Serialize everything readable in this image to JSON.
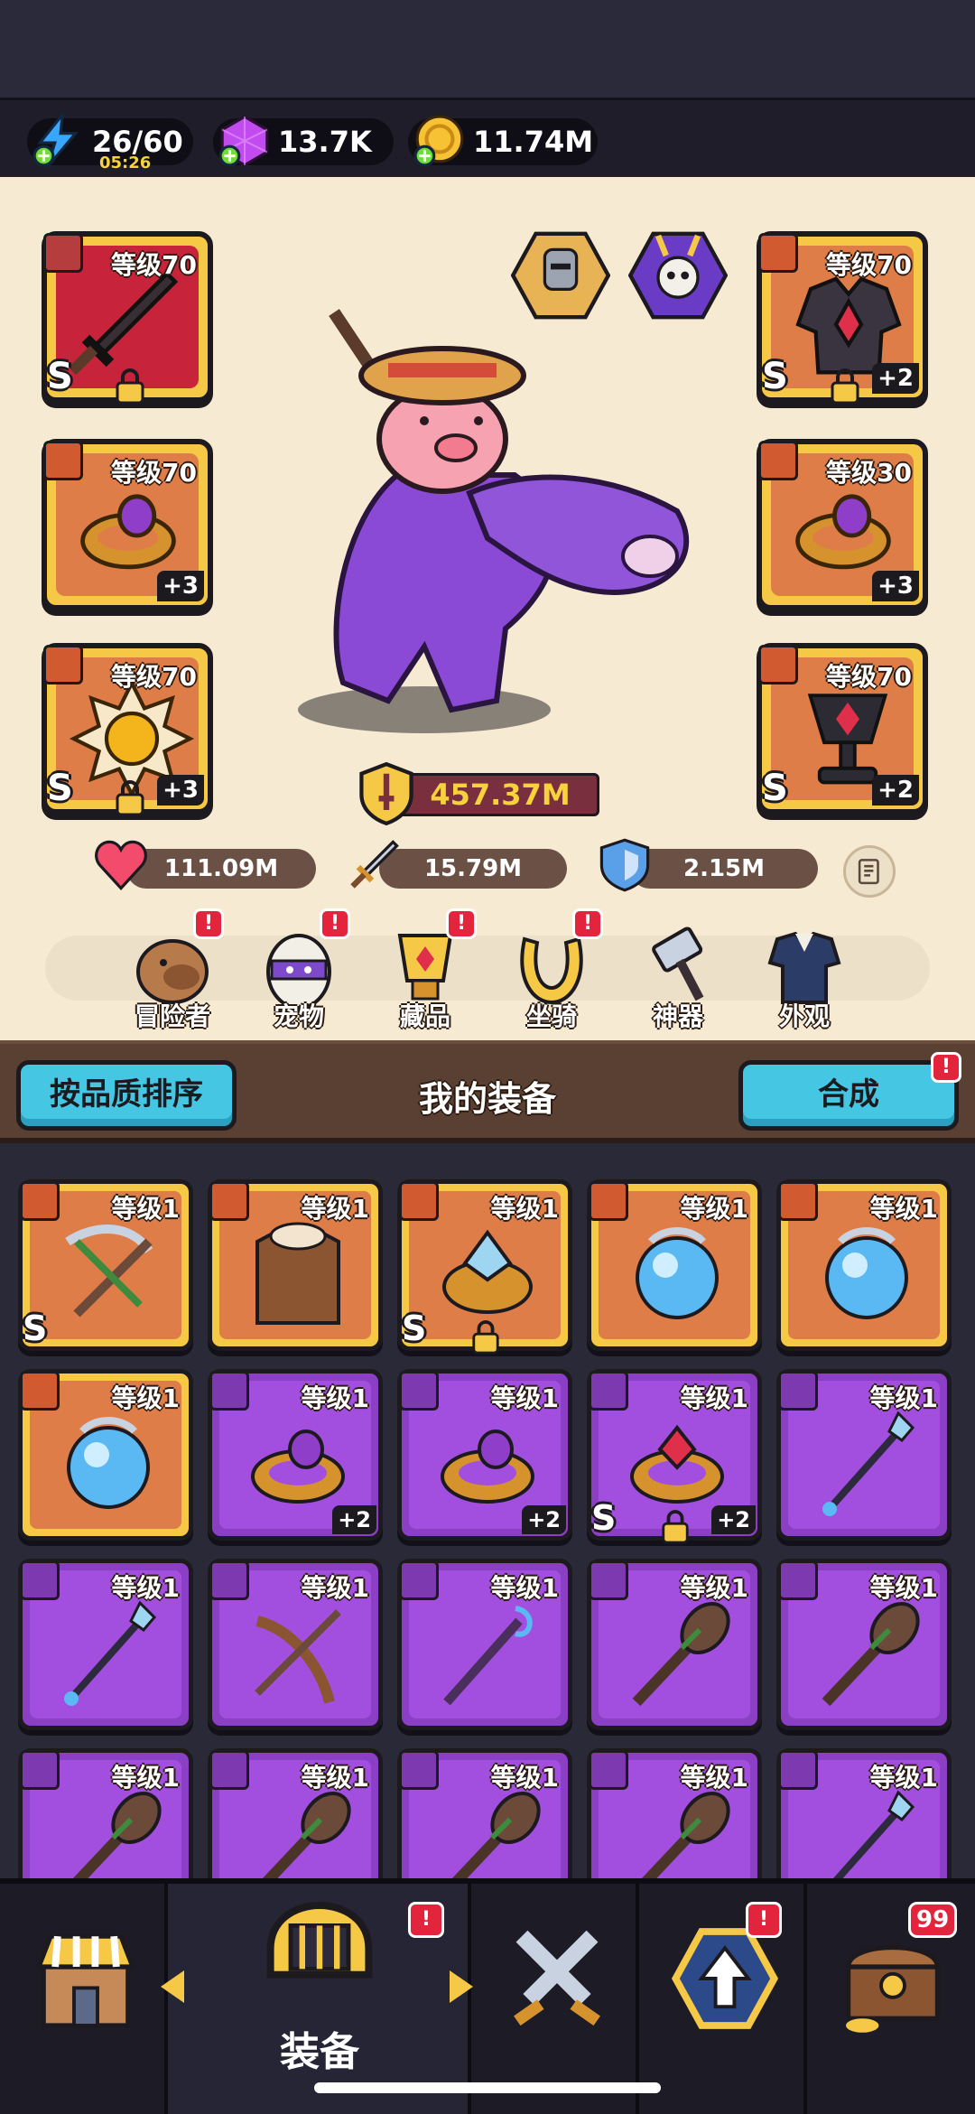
{
  "resources": {
    "energy": {
      "value": "26/60",
      "timer": "05:26",
      "icon": "lightning-plus-icon"
    },
    "gems": {
      "value": "13.7K",
      "icon": "purple-gem-plus-icon"
    },
    "coins": {
      "value": "11.74M",
      "icon": "gold-coin-plus-icon"
    }
  },
  "equipment_slots": {
    "weapon": {
      "level": "等级70",
      "grade": "S",
      "locked": true,
      "icon": "sword-icon"
    },
    "armor": {
      "level": "等级70",
      "grade": "S",
      "plus": "+2",
      "locked": true,
      "icon": "armor-icon"
    },
    "ring_left": {
      "level": "等级70",
      "plus": "+3",
      "icon": "ring-icon"
    },
    "ring_right": {
      "level": "等级30",
      "plus": "+3",
      "icon": "ring-icon"
    },
    "necklace_left": {
      "level": "等级70",
      "grade": "S",
      "plus": "+3",
      "locked": true,
      "icon": "amulet-icon"
    },
    "necklace_right": {
      "level": "等级70",
      "grade": "S",
      "plus": "+2",
      "icon": "chalice-icon"
    }
  },
  "power": {
    "value": "457.37M",
    "icon": "shield-sword-icon"
  },
  "stats": {
    "hp": {
      "value": "111.09M",
      "icon": "heart-icon"
    },
    "attack": {
      "value": "15.79M",
      "icon": "sword-icon"
    },
    "defense": {
      "value": "2.15M",
      "icon": "shield-icon"
    }
  },
  "menu": [
    {
      "label": "冒险者",
      "icon": "capybara-icon",
      "badge": "!"
    },
    {
      "label": "宠物",
      "icon": "egg-icon",
      "badge": "!"
    },
    {
      "label": "藏品",
      "icon": "trophy-icon",
      "badge": "!"
    },
    {
      "label": "坐骑",
      "icon": "horseshoe-icon",
      "badge": "!"
    },
    {
      "label": "神器",
      "icon": "hammer-icon"
    },
    {
      "label": "外观",
      "icon": "outfit-icon"
    }
  ],
  "inventory_header": {
    "sort_label": "按品质排序",
    "title": "我的装备",
    "merge_label": "合成",
    "merge_badge": "!"
  },
  "inventory": [
    {
      "level": "等级1",
      "rarity": "orange",
      "item": "crossbow",
      "grade": "S"
    },
    {
      "level": "等级1",
      "rarity": "orange",
      "item": "fur-armor"
    },
    {
      "level": "等级1",
      "rarity": "orange",
      "item": "crystal-ring",
      "grade": "S",
      "locked": true
    },
    {
      "level": "等级1",
      "rarity": "orange",
      "item": "blue-orb"
    },
    {
      "level": "等级1",
      "rarity": "orange",
      "item": "blue-orb"
    },
    {
      "level": "等级1",
      "rarity": "orange",
      "item": "blue-orb"
    },
    {
      "level": "等级1",
      "rarity": "purple",
      "item": "gold-ring",
      "plus": "+2"
    },
    {
      "level": "等级1",
      "rarity": "purple",
      "item": "gold-ring",
      "plus": "+2"
    },
    {
      "level": "等级1",
      "rarity": "purple",
      "item": "ruby-ring",
      "plus": "+2",
      "grade": "S",
      "locked": true
    },
    {
      "level": "等级1",
      "rarity": "purple",
      "item": "ice-spear"
    },
    {
      "level": "等级1",
      "rarity": "purple",
      "item": "ice-spear"
    },
    {
      "level": "等级1",
      "rarity": "purple",
      "item": "crossed-bow"
    },
    {
      "level": "等级1",
      "rarity": "purple",
      "item": "staff"
    },
    {
      "level": "等级1",
      "rarity": "purple",
      "item": "club"
    },
    {
      "level": "等级1",
      "rarity": "purple",
      "item": "club"
    },
    {
      "level": "等级1",
      "rarity": "purple",
      "item": "club"
    },
    {
      "level": "等级1",
      "rarity": "purple",
      "item": "club"
    },
    {
      "level": "等级1",
      "rarity": "purple",
      "item": "club"
    },
    {
      "level": "等级1",
      "rarity": "purple",
      "item": "club"
    },
    {
      "level": "等级1",
      "rarity": "purple",
      "item": "ice-spear"
    }
  ],
  "bottom_nav": {
    "shop": {
      "icon": "shop-icon"
    },
    "equipment": {
      "label": "装备",
      "icon": "helmet-icon",
      "badge": "!"
    },
    "battle": {
      "icon": "crossed-swords-icon"
    },
    "upgrade": {
      "icon": "upgrade-arrow-icon",
      "badge": "!"
    },
    "chest": {
      "icon": "treasure-chest-icon",
      "badge": "99"
    }
  }
}
